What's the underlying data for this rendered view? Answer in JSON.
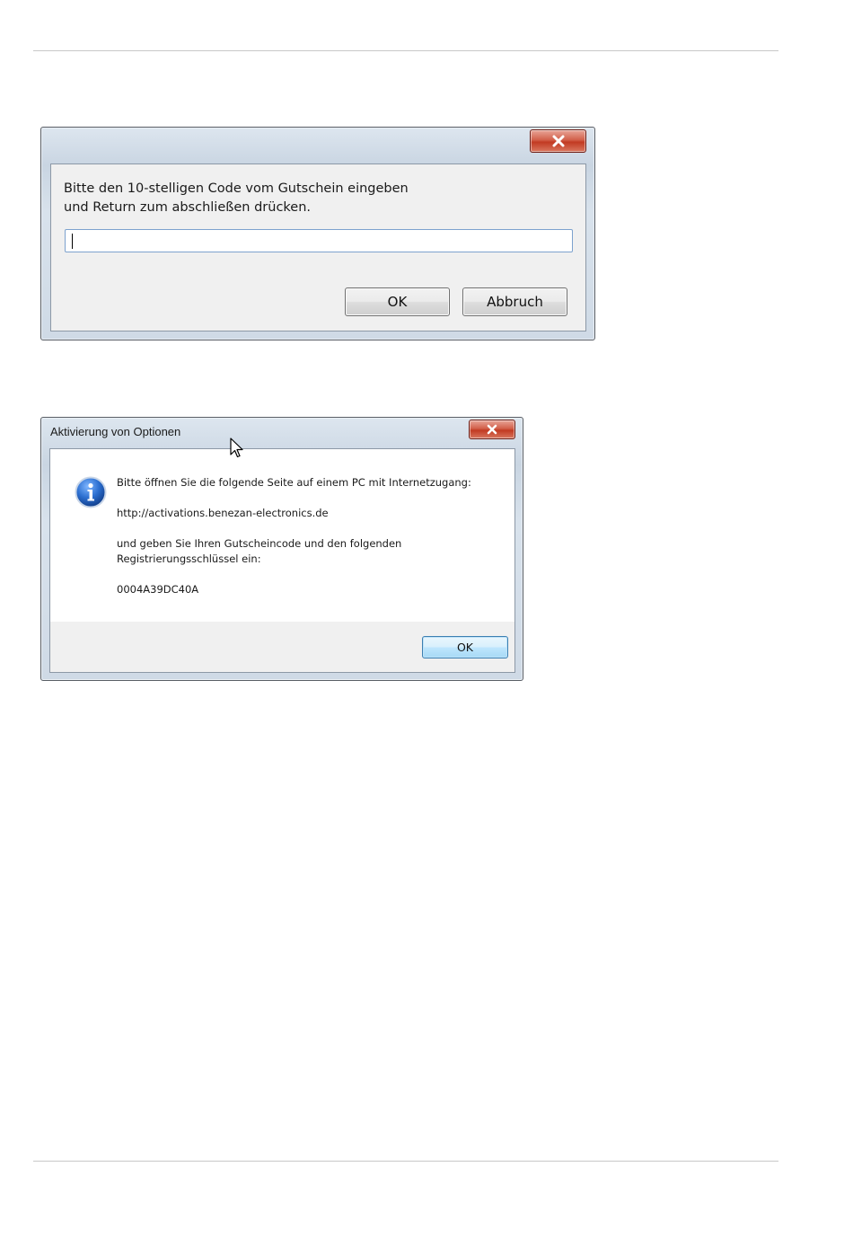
{
  "dialog_code": {
    "prompt_line1": "Bitte den 10-stelligen Code vom Gutschein eingeben",
    "prompt_line2": "und Return zum abschließen drücken.",
    "code_value": "",
    "ok_label": "OK",
    "cancel_label": "Abbruch",
    "close_icon": "close-icon"
  },
  "dialog_activation": {
    "title": "Aktivierung von Optionen",
    "line1": "Bitte öffnen Sie die folgende Seite auf einem PC mit Internetzugang:",
    "url": "http://activations.benezan-electronics.de",
    "line3": "und geben Sie Ihren Gutscheincode und den folgenden",
    "line4": "Registrierungsschlüssel ein:",
    "key": "0004A39DC40A",
    "ok_label": "OK",
    "icon": "info-icon",
    "close_icon": "close-icon"
  },
  "colors": {
    "close_button": "#c23a22",
    "info_icon": "#1f5fb8",
    "default_button_border": "#3c7fb1"
  }
}
